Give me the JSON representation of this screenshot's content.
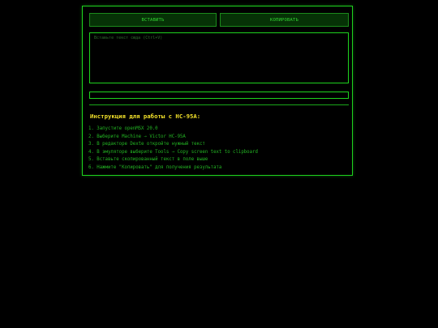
{
  "buttons": {
    "paste_label": "ВСТАВИТЬ",
    "copy_label": "КОПИРОВАТЬ"
  },
  "input": {
    "placeholder": "Вставьте текст сюда (Ctrl+V)",
    "value": ""
  },
  "output": {
    "text": ""
  },
  "instructions": {
    "title": "Инструкция для работы с HC-95A:",
    "steps": [
      "1. Запустите openMSX 20.0",
      "2. Выберите Machine → Victor HC-95A",
      "3. В редакторе Dexte откройте нужный текст",
      "4. В эмуляторе выберите Tools → Copy screen text to clipboard",
      "5. Вставьте скопированный текст в поле выше",
      "6. Нажмите \"Копировать\" для получения результата"
    ]
  },
  "colors": {
    "accent": "#1ed21e",
    "title": "#f1e02a",
    "background": "#000000"
  }
}
